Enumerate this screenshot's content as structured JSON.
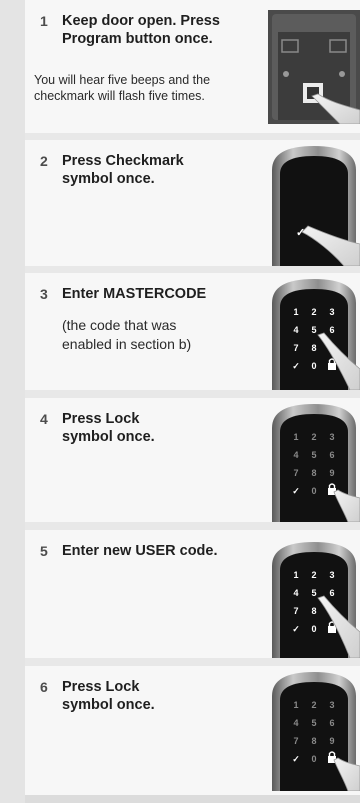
{
  "steps": [
    {
      "number": "1",
      "title_line1": "Keep door open. Press",
      "title_line2": "Program button once.",
      "note_line1": "You will hear five beeps and the",
      "note_line2": "checkmark will flash five times."
    },
    {
      "number": "2",
      "title_line1": "Press Checkmark",
      "title_line2": "symbol once."
    },
    {
      "number": "3",
      "title_line1": "Enter MASTERCODE",
      "note_line1": "(the code that was",
      "note_line2": "enabled in section b)"
    },
    {
      "number": "4",
      "title_line1": "Press Lock",
      "title_line2": "symbol once."
    },
    {
      "number": "5",
      "title_line1": "Enter new USER code."
    },
    {
      "number": "6",
      "title_line1": "Press Lock",
      "title_line2": "symbol once."
    }
  ],
  "keypad": {
    "row1": [
      "1",
      "2",
      "3"
    ],
    "row2": [
      "4",
      "5",
      "6"
    ],
    "row3": [
      "7",
      "8",
      "9"
    ],
    "row4": [
      "✓",
      "0"
    ]
  }
}
